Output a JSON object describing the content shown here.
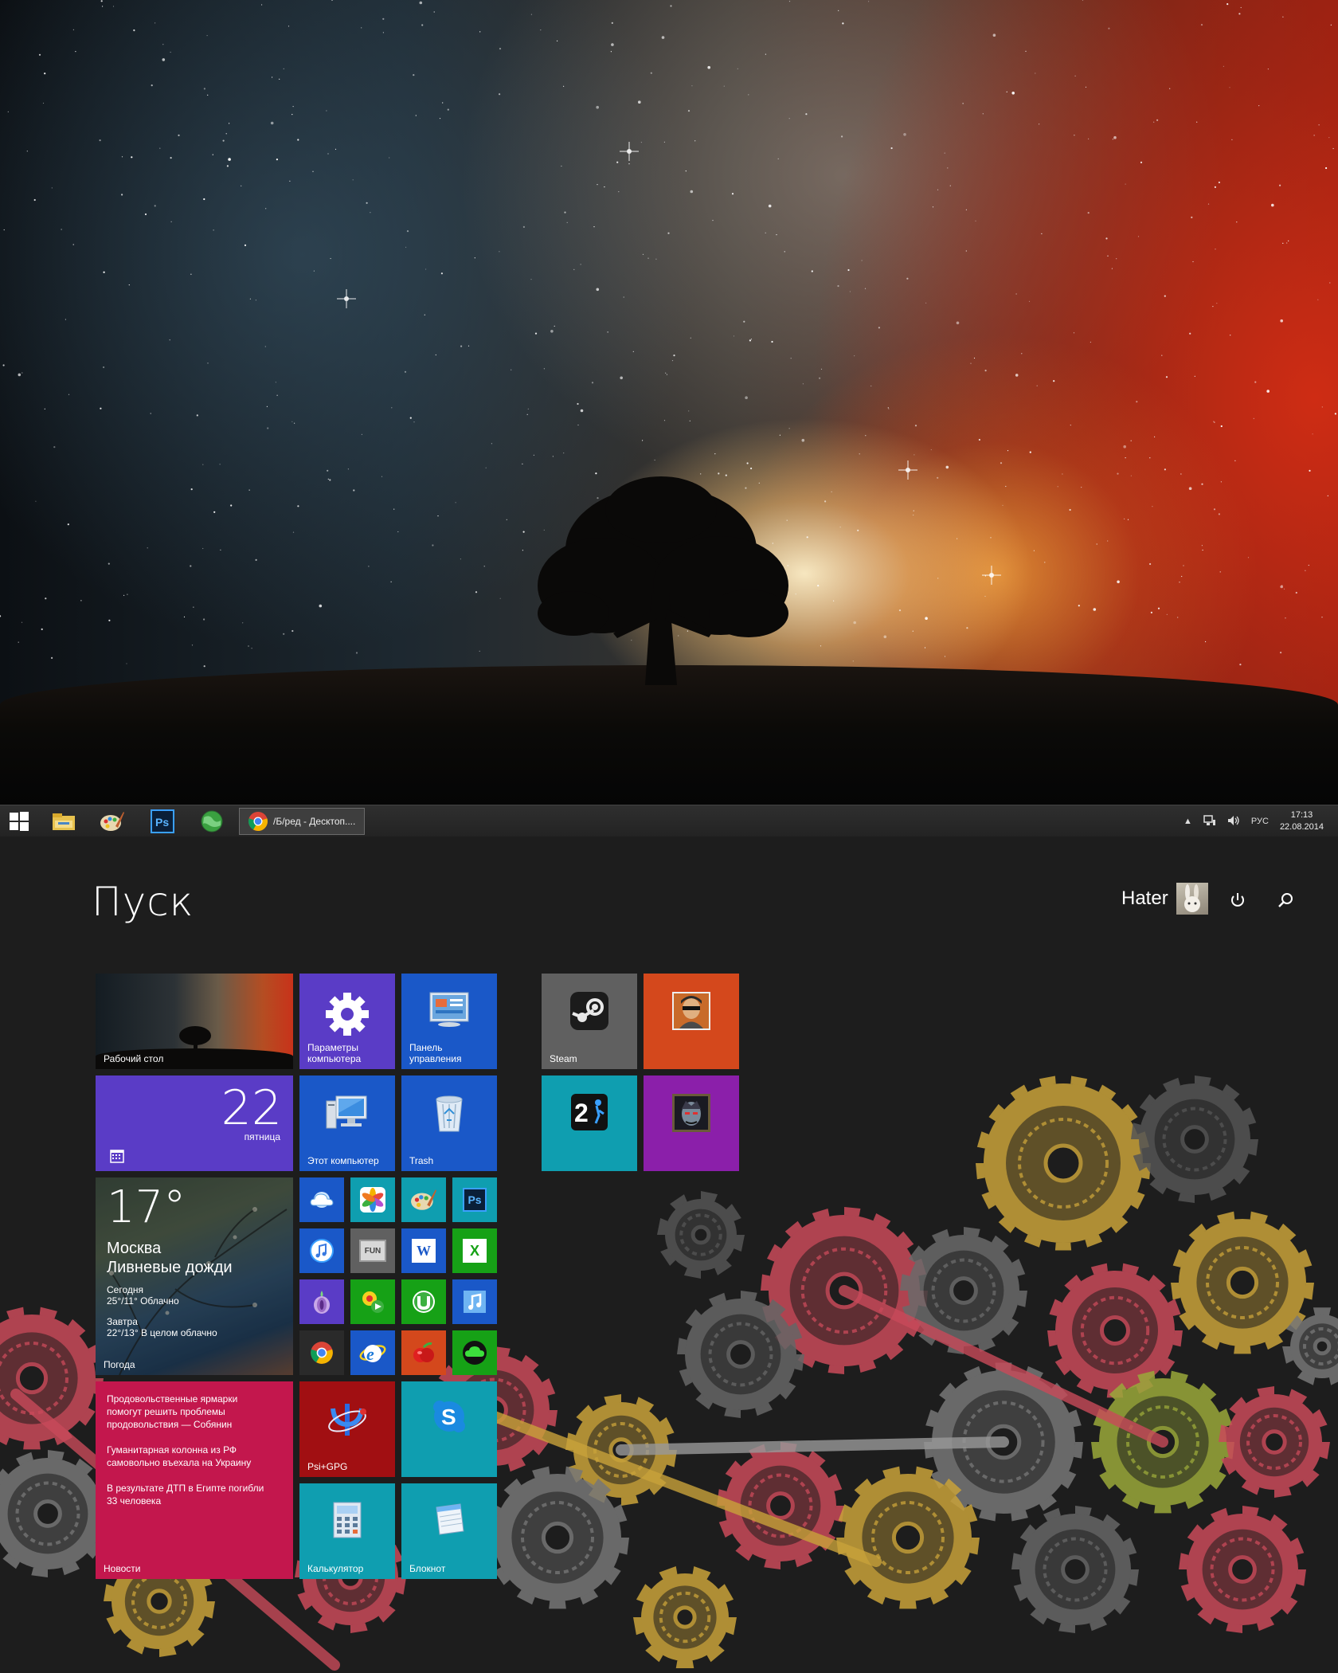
{
  "taskbar": {
    "active_task_title": "/Б/ред - Десктоп....",
    "language": "РУС",
    "time": "17:13",
    "date": "22.08.2014",
    "pinned_icons": [
      "windows-icon",
      "file-explorer-icon",
      "paint-icon",
      "photoshop-icon",
      "globe-icon",
      "chrome-icon"
    ]
  },
  "start": {
    "title": "Пуск",
    "user_name": "Hater",
    "tiles": {
      "desktop": "Рабочий стол",
      "settings": "Параметры компьютера",
      "control_panel": "Панель управления",
      "calendar_day": "22",
      "calendar_weekday": "пятница",
      "this_pc": "Этот компьютер",
      "trash": "Trash",
      "weather": {
        "temp": "17°",
        "city": "Москва",
        "condition": "Ливневые дожди",
        "today_label": "Сегодня",
        "today_forecast": "25°/11° Облачно",
        "tomorrow_label": "Завтра",
        "tomorrow_forecast": "22°/13° В целом облачно",
        "label": "Погода"
      },
      "news": {
        "items": [
          "Продовольственные ярмарки помогут решить проблемы продовольствия — Собянин",
          "Гуманитарная колонна из РФ самовольно въехала на Украину",
          "В результате ДТП в Египте погибли 33 человека"
        ],
        "label": "Новости"
      },
      "psi": "Psi+GPG",
      "skype_icon": "skype-icon",
      "calculator": "Калькулятор",
      "notepad": "Блокнот",
      "steam": "Steam",
      "ps_badge": "Ps",
      "word_badge": "W",
      "excel_badge": "X",
      "fun_badge": "FUN"
    }
  },
  "colors": {
    "purple": "#5a3cc6",
    "blue": "#1a58c8",
    "teal": "#0f9eb0",
    "magenta": "#c3174d",
    "steam_gray": "#606060",
    "orange": "#d4481c",
    "violet": "#8b1faa",
    "green": "#16a116",
    "dark_red": "#a10f12"
  }
}
